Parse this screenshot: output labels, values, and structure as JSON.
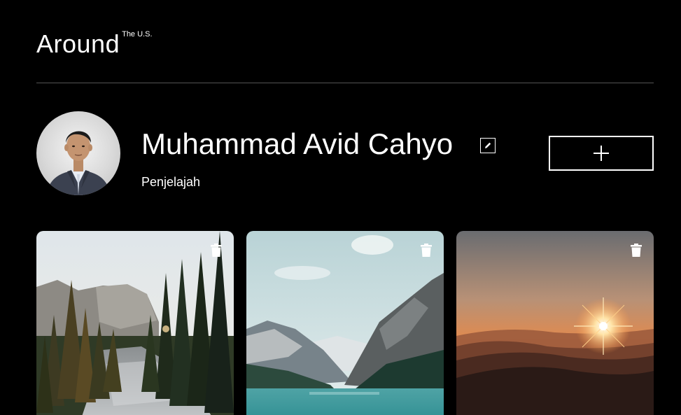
{
  "header": {
    "logo": "Around",
    "logo_sup": "The U.S."
  },
  "profile": {
    "name": "Muhammad Avid Cahyo",
    "role": "Penjelajah",
    "avatar_icon": "person-avatar",
    "edit_icon": "pencil-icon",
    "add_icon": "plus-icon"
  },
  "cards": [
    {
      "scene": "forest-river",
      "action_icon": "trash-icon"
    },
    {
      "scene": "mountain-lake",
      "action_icon": "trash-icon"
    },
    {
      "scene": "sunset-hills",
      "action_icon": "trash-icon"
    }
  ],
  "colors": {
    "background": "#000000",
    "text": "#ffffff",
    "divider": "#545454"
  }
}
